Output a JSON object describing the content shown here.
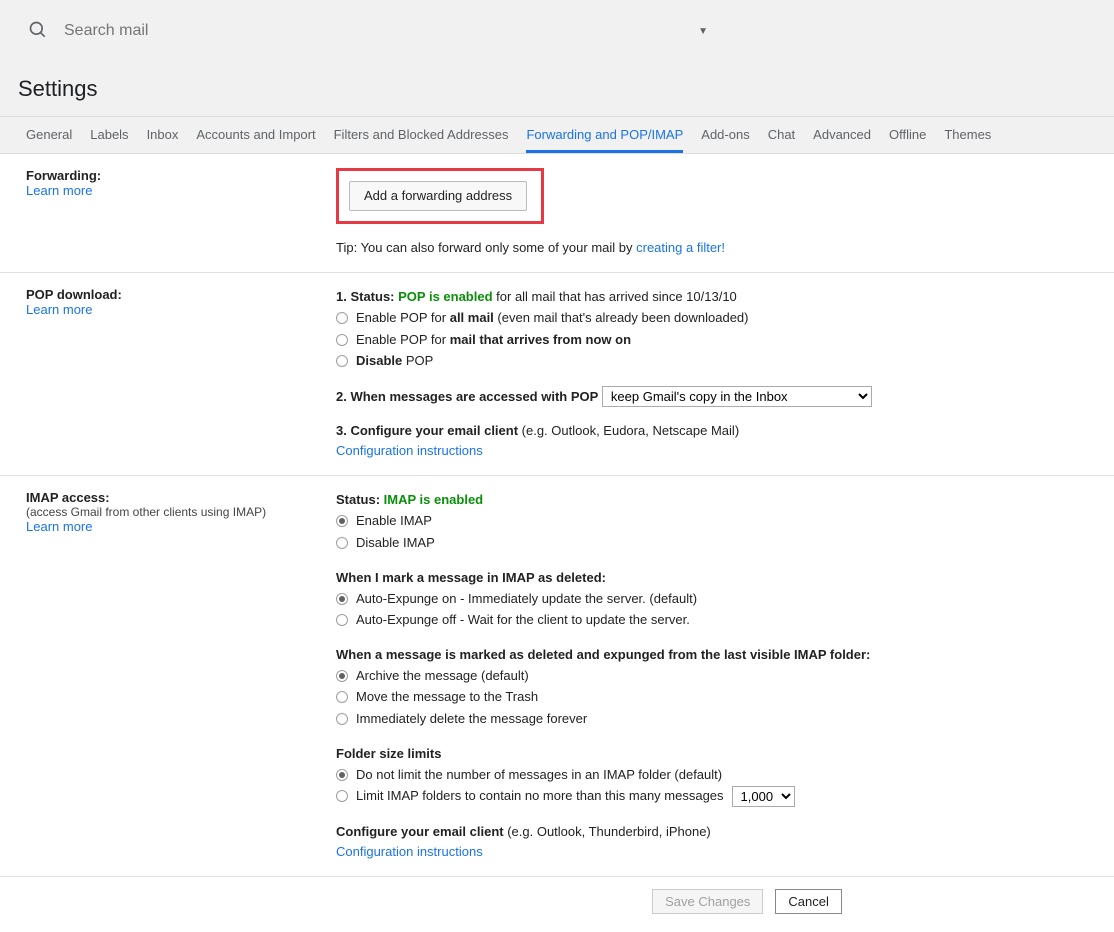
{
  "search": {
    "placeholder": "Search mail"
  },
  "page_title": "Settings",
  "tabs": [
    "General",
    "Labels",
    "Inbox",
    "Accounts and Import",
    "Filters and Blocked Addresses",
    "Forwarding and POP/IMAP",
    "Add-ons",
    "Chat",
    "Advanced",
    "Offline",
    "Themes"
  ],
  "forwarding": {
    "heading": "Forwarding:",
    "learn_more": "Learn more",
    "add_button": "Add a forwarding address",
    "tip_prefix": "Tip: You can also forward only some of your mail by ",
    "tip_link": "creating a filter!"
  },
  "pop": {
    "heading": "POP download:",
    "learn_more": "Learn more",
    "status_label": "1. Status: ",
    "status_value": "POP is enabled",
    "status_suffix": " for all mail that has arrived since 10/13/10",
    "opt1_a": "Enable POP for ",
    "opt1_b": "all mail",
    "opt1_c": " (even mail that's already been downloaded)",
    "opt2_a": "Enable POP for ",
    "opt2_b": "mail that arrives from now on",
    "opt3_a": "Disable",
    "opt3_b": " POP",
    "step2_label": "2. When messages are accessed with POP",
    "step2_select": "keep Gmail's copy in the Inbox",
    "step3_label": "3. Configure your email client ",
    "step3_suffix": "(e.g. Outlook, Eudora, Netscape Mail)",
    "config_link": "Configuration instructions"
  },
  "imap": {
    "heading": "IMAP access:",
    "sub": "(access Gmail from other clients using IMAP)",
    "learn_more": "Learn more",
    "status_label": "Status: ",
    "status_value": "IMAP is enabled",
    "enable": "Enable IMAP",
    "disable": "Disable IMAP",
    "deleted_heading": "When I mark a message in IMAP as deleted:",
    "del_opt1": "Auto-Expunge on - Immediately update the server. (default)",
    "del_opt2": "Auto-Expunge off - Wait for the client to update the server.",
    "expunged_heading": "When a message is marked as deleted and expunged from the last visible IMAP folder:",
    "exp_opt1": "Archive the message (default)",
    "exp_opt2": "Move the message to the Trash",
    "exp_opt3": "Immediately delete the message forever",
    "folder_heading": "Folder size limits",
    "folder_opt1": "Do not limit the number of messages in an IMAP folder (default)",
    "folder_opt2": "Limit IMAP folders to contain no more than this many messages",
    "folder_select": "1,000",
    "configure_label": "Configure your email client ",
    "configure_suffix": "(e.g. Outlook, Thunderbird, iPhone)",
    "config_link": "Configuration instructions"
  },
  "footer": {
    "save": "Save Changes",
    "cancel": "Cancel"
  }
}
